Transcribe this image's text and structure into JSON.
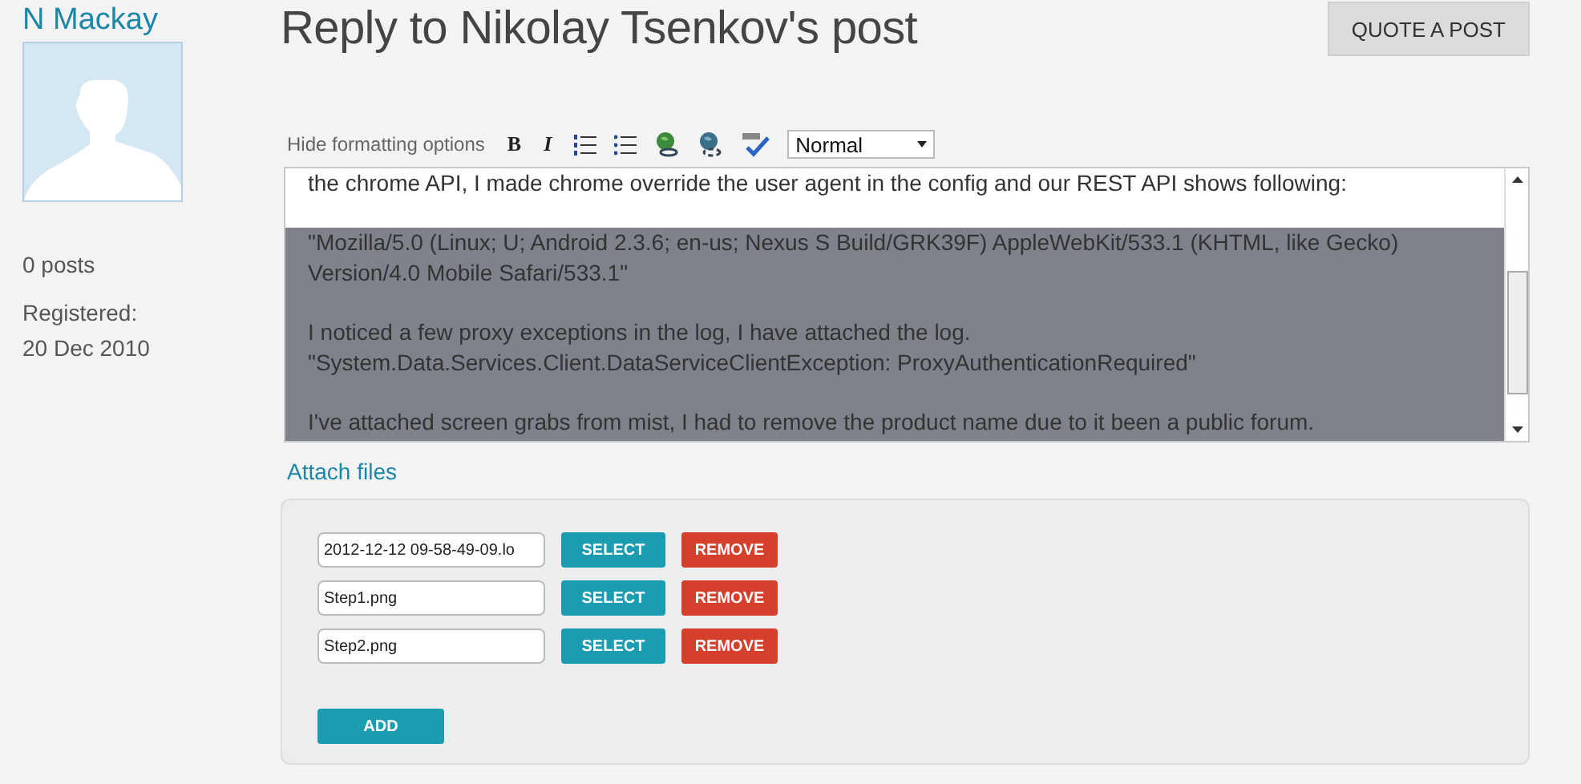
{
  "author": {
    "name": "N Mackay",
    "posts": "0 posts",
    "registered_label": "Registered:",
    "registered_date": "20 Dec 2010"
  },
  "page": {
    "title": "Reply to Nikolay Tsenkov's post",
    "quote_button": "QUOTE A POST"
  },
  "toolbar": {
    "toggle": "Hide formatting options",
    "bold": "B",
    "italic": "I",
    "format_select": "Normal"
  },
  "editor": {
    "paragraphs": [
      "the chrome API, I made chrome override the user agent in the config and our REST API shows following:",
      "\"Mozilla/5.0 (Linux; U; Android 2.3.6; en-us; Nexus S Build/GRK39F) AppleWebKit/533.1 (KHTML, like Gecko) Version/4.0 Mobile Safari/533.1\"",
      "I noticed a few proxy exceptions in the log, I have attached the log.\n\"System.Data.Services.Client.DataServiceClientException: ProxyAuthenticationRequired\"",
      "I've attached screen grabs from mist, I had to remove the product name due to it been a public forum."
    ]
  },
  "attach_link": "Attach files",
  "files": [
    {
      "value": "2012-12-12 09-58-49-09.lo",
      "select": "SELECT",
      "remove": "REMOVE"
    },
    {
      "value": "Step1.png",
      "select": "SELECT",
      "remove": "REMOVE"
    },
    {
      "value": "Step2.png",
      "select": "SELECT",
      "remove": "REMOVE"
    }
  ],
  "add_button": "ADD"
}
